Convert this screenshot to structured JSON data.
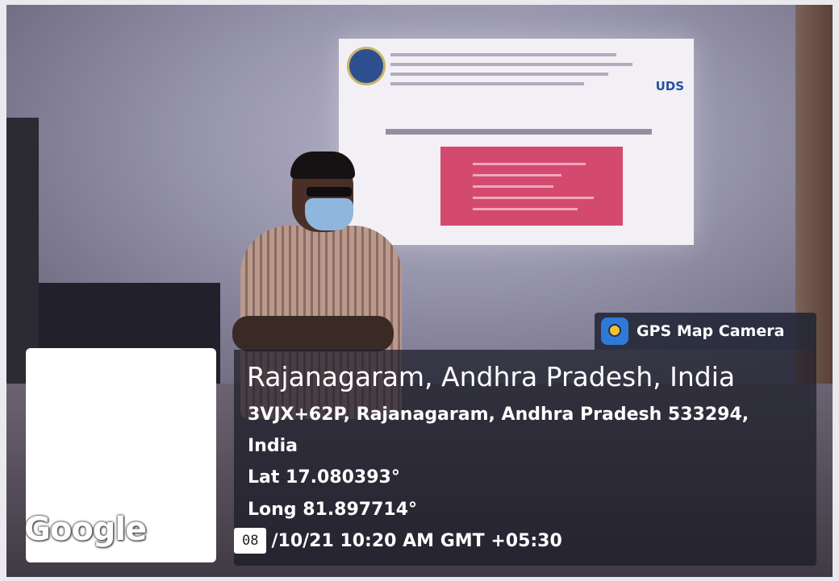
{
  "badge": {
    "icon": "gps-map-camera-app-icon",
    "label": "GPS Map Camera"
  },
  "location": {
    "title": "Rajanagaram, Andhra Pradesh, India",
    "address_line1": "3VJX+62P, Rajanagaram, Andhra Pradesh 533294,",
    "address_line2": "India",
    "lat": "Lat 17.080393°",
    "long": "Long 81.897714°",
    "date_box": "08",
    "date_time": "/10/21 10:20 AM GMT +05:30"
  },
  "map": {
    "logo": "Google"
  },
  "colors": {
    "overlay": "#1a1c28",
    "badge_icon": "#2f7ad6",
    "projector_box": "#d44a6e"
  }
}
